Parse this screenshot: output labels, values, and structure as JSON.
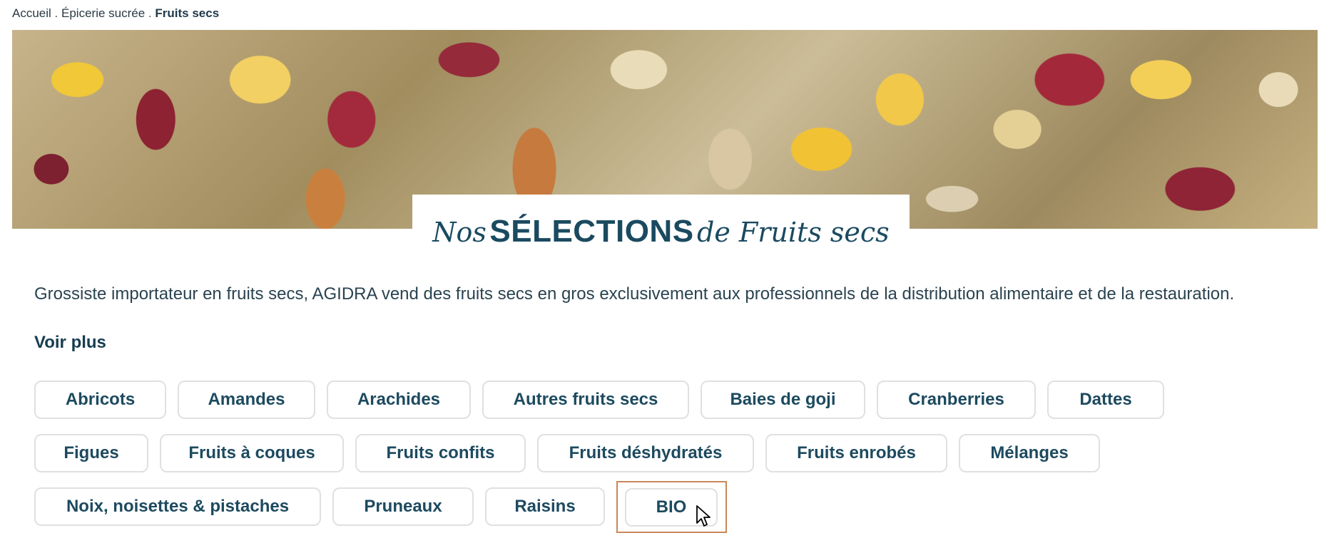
{
  "breadcrumb": {
    "items": [
      "Accueil",
      "Épicerie sucrée",
      "Fruits secs"
    ],
    "separator": "."
  },
  "hero": {
    "title_prefix": "Nos",
    "title_strong": "SÉLECTIONS",
    "title_suffix": "de Fruits secs"
  },
  "intro": {
    "text": "Grossiste importateur en fruits secs, AGIDRA vend des fruits secs en gros exclusivement aux professionnels de la distribution alimentaire et de la restauration.",
    "more_label": "Voir plus"
  },
  "categories": {
    "row1": [
      "Abricots",
      "Amandes",
      "Arachides",
      "Autres fruits secs",
      "Baies de goji",
      "Cranberries",
      "Dattes"
    ],
    "row2": [
      "Figues",
      "Fruits à coques",
      "Fruits confits",
      "Fruits déshydratés",
      "Fruits enrobés",
      "Mélanges"
    ],
    "row3": [
      "Noix, noisettes & pistaches",
      "Pruneaux",
      "Raisins",
      "BIO"
    ]
  },
  "colors": {
    "accent": "#1d4a5f",
    "focus_border": "#c9875a"
  }
}
